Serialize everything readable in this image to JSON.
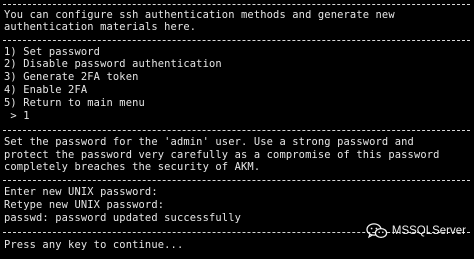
{
  "intro": {
    "line1": "You can configure ssh authentication methods and generate new",
    "line2": "authentication materials here."
  },
  "menu": {
    "items": [
      "1) Set password",
      "2) Disable password authentication",
      "3) Generate 2FA token",
      "4) Enable 2FA",
      "5) Return to main menu"
    ],
    "prompt": " > 1"
  },
  "description": {
    "line1": "Set the password for the 'admin' user. Use a strong password and",
    "line2": "protect the password very carefully as a compromise of this password",
    "line3": "completely breaches the security of AKM."
  },
  "password_output": {
    "line1": "Enter new UNIX password:",
    "line2": "Retype new UNIX password:",
    "line3": "passwd: password updated successfully"
  },
  "footer": {
    "prompt": "Press any key to continue..."
  },
  "watermark": {
    "text": "MSSQLServer",
    "icon": "wechat-icon"
  },
  "colors": {
    "background": "#000000",
    "text": "#e6e6e6"
  }
}
